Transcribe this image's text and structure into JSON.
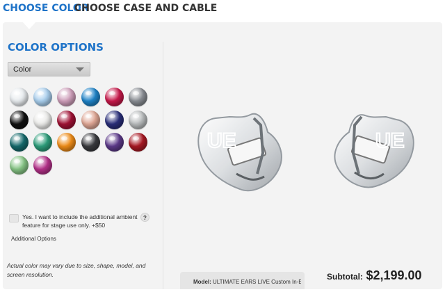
{
  "tabs": {
    "active": "CHOOSE COLOR",
    "next": "CHOOSE CASE AND CABLE"
  },
  "heading": "COLOR OPTIONS",
  "color_select": {
    "value": "Color"
  },
  "swatches": [
    {
      "name": "clear-frost",
      "color": "#e8ecef"
    },
    {
      "name": "light-blue",
      "color": "#a9cfee"
    },
    {
      "name": "pink-pearl",
      "color": "#cf9fbb"
    },
    {
      "name": "blue",
      "color": "#1f84c9"
    },
    {
      "name": "red-pink",
      "color": "#c8184a"
    },
    {
      "name": "smoke-gray",
      "color": "#8a8e94"
    },
    {
      "name": "black",
      "color": "#111111"
    },
    {
      "name": "white-pearl",
      "color": "#ececea"
    },
    {
      "name": "crimson",
      "color": "#a11235"
    },
    {
      "name": "peach",
      "color": "#e0a795"
    },
    {
      "name": "navy",
      "color": "#2a2f7a"
    },
    {
      "name": "silver",
      "color": "#b9bcbd"
    },
    {
      "name": "teal",
      "color": "#156a6c"
    },
    {
      "name": "green-pearl",
      "color": "#2d9e7b"
    },
    {
      "name": "orange",
      "color": "#f08d18"
    },
    {
      "name": "charcoal",
      "color": "#3a3b3f"
    },
    {
      "name": "purple",
      "color": "#5d3a8a"
    },
    {
      "name": "dark-red",
      "color": "#a91823"
    },
    {
      "name": "mint-green",
      "color": "#86c585"
    },
    {
      "name": "magenta",
      "color": "#b5318a"
    }
  ],
  "ambient_option": {
    "text": "Yes. I want to include the additional ambient feature for stage use only. +$50",
    "help": "?"
  },
  "additional_options": "Additional Options",
  "disclaimer": "Actual color may vary due to size, shape, model, and screen resolution.",
  "model": {
    "label": "Model:",
    "value": "ULTIMATE EARS LIVE Custom In-Ear Monitors"
  },
  "subtotal": {
    "label": "Subtotal:",
    "value": "$2,199.00"
  },
  "product_logo_text": "UE"
}
